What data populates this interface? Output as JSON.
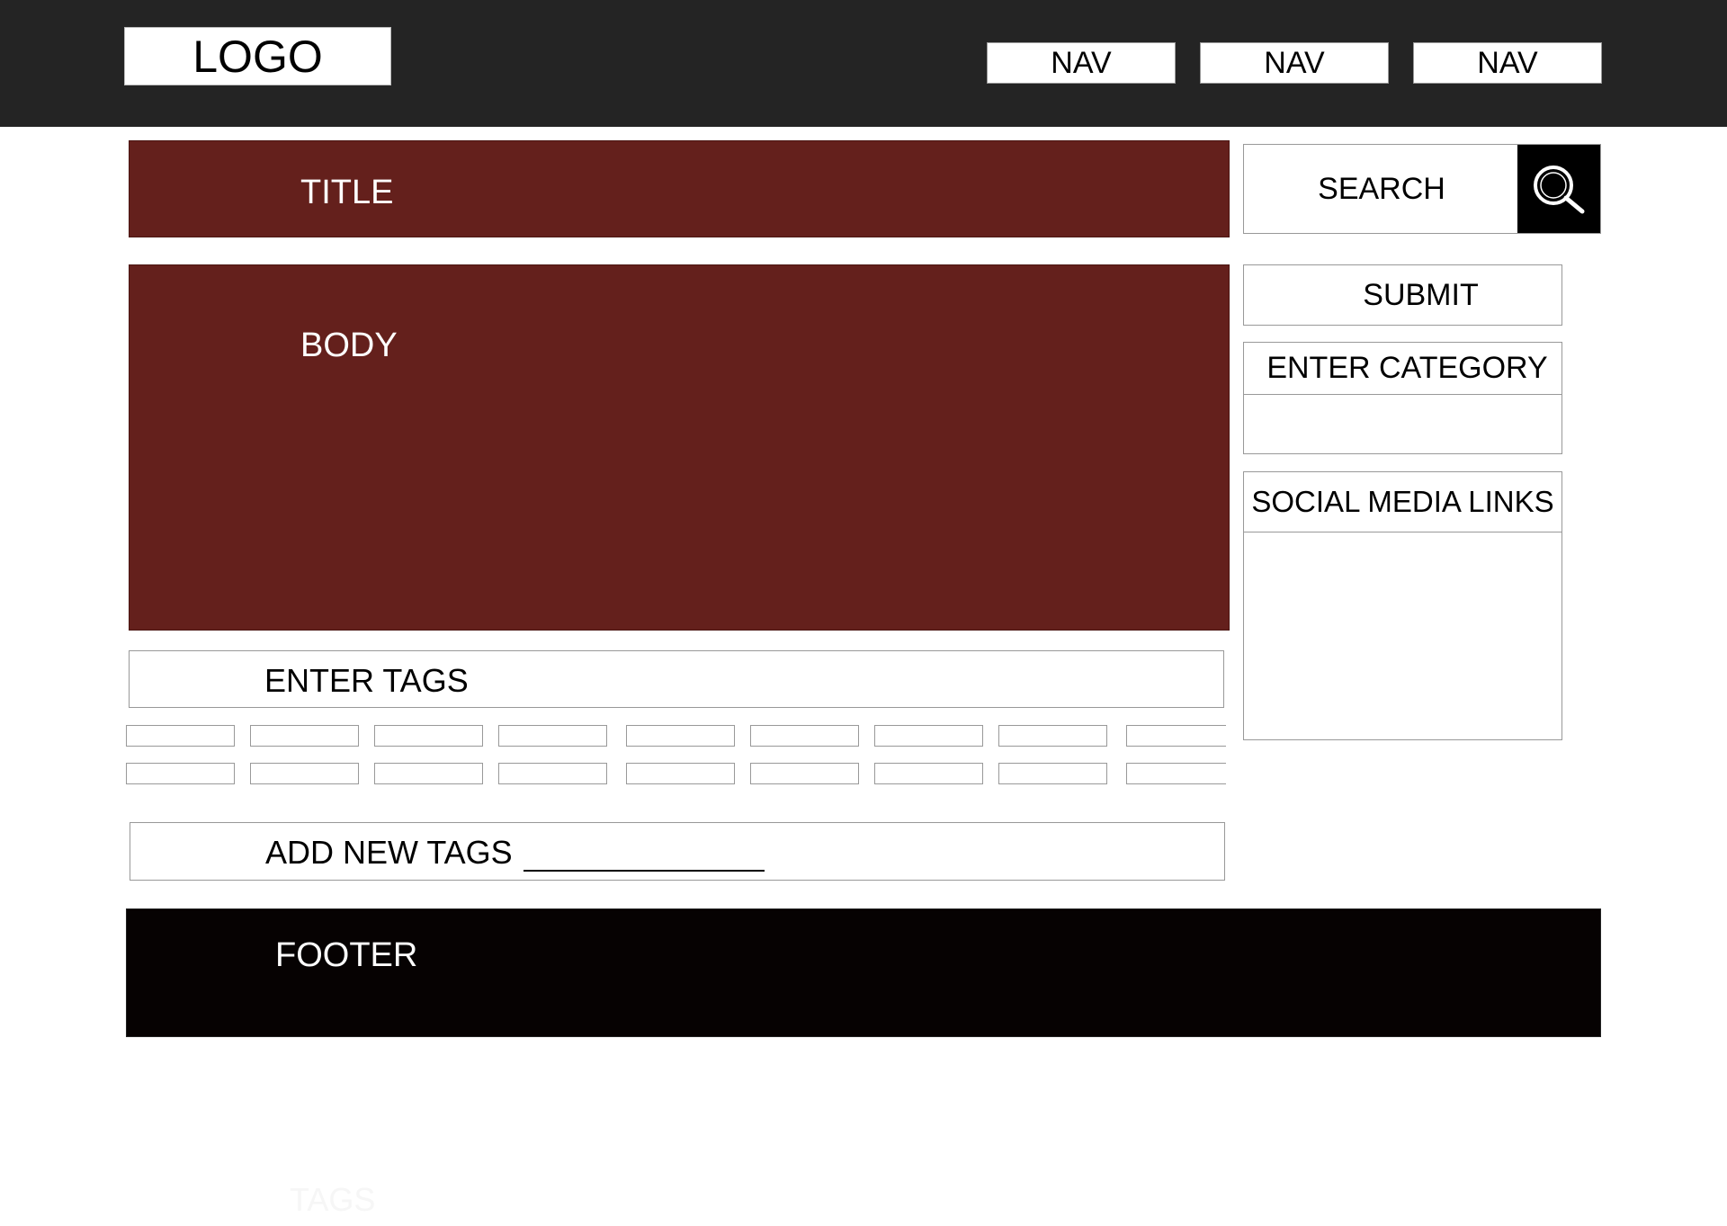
{
  "header": {
    "logo": "LOGO",
    "nav": [
      "NAV",
      "NAV",
      "NAV"
    ]
  },
  "main": {
    "title": "TITLE",
    "body": "BODY"
  },
  "sidebar": {
    "search": "SEARCH",
    "search_icon": "magnifier-icon",
    "submit": "SUBMIT",
    "category": "ENTER CATEGORY",
    "social": "SOCIAL MEDIA LINKS"
  },
  "tags": {
    "enter": "ENTER TAGS",
    "add_new": "ADD NEW TAGS",
    "ghost": "TAGS"
  },
  "footer": {
    "text": "FOOTER"
  },
  "colors": {
    "header_bg": "#242424",
    "accent": "#64201c",
    "footer_bg": "#060202"
  }
}
